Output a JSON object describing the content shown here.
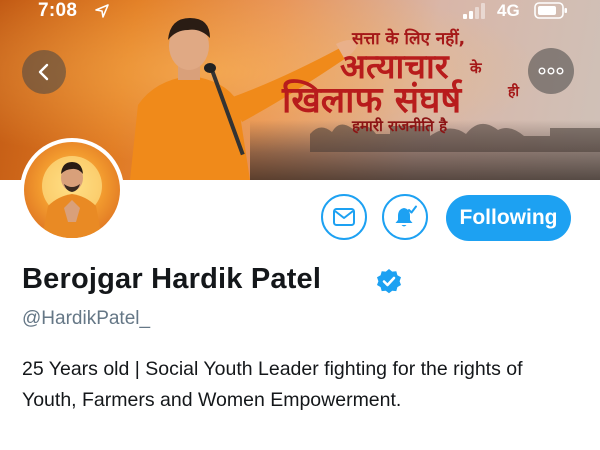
{
  "status_bar": {
    "time": "7:08",
    "network": "4G",
    "icons": [
      "location-arrow-icon",
      "signal-icon",
      "battery-icon"
    ]
  },
  "banner": {
    "line1": "सत्ता के लिए नहीं,",
    "line2": "अत्याचार",
    "line2_suffix": "के",
    "line3": "खिलाफ संघर्ष",
    "line3_suffix": "ही",
    "line4": "हमारी राजनीति है"
  },
  "actions": {
    "message_icon": "envelope-icon",
    "notify_icon": "bell-check-icon",
    "follow_label": "Following"
  },
  "profile": {
    "display_name": "Berojgar Hardik Patel",
    "handle": "@HardikPatel_",
    "bio": "25 Years old | Social Youth Leader fighting for the rights of Youth, Farmers and Women Empowerment."
  },
  "colors": {
    "accent": "#1da1f2",
    "text_primary": "#14171a",
    "text_secondary": "#657786",
    "banner_text": "#b81c1c"
  }
}
